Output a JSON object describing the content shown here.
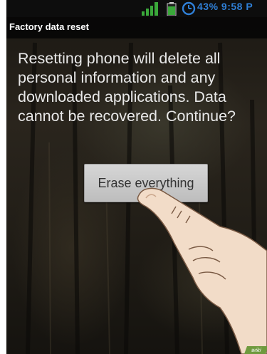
{
  "status_bar": {
    "text": "43% 9:58 P",
    "icons": [
      "signal-icon",
      "battery-icon",
      "alarm-icon"
    ]
  },
  "header": {
    "title": "Factory data reset"
  },
  "message": {
    "lines": [
      "Resetting phone will delete all",
      "personal information and any",
      "downloaded applications. Data",
      "cannot be recovered. Continue?"
    ]
  },
  "button": {
    "label": "Erase everything"
  },
  "watermark": {
    "text": "wiki"
  },
  "colors": {
    "status_text": "#2f7fd6",
    "button_bg": "#c9c9c9",
    "button_text": "#333333",
    "battery": "#3aa83a",
    "signal": "#3aa83a"
  }
}
